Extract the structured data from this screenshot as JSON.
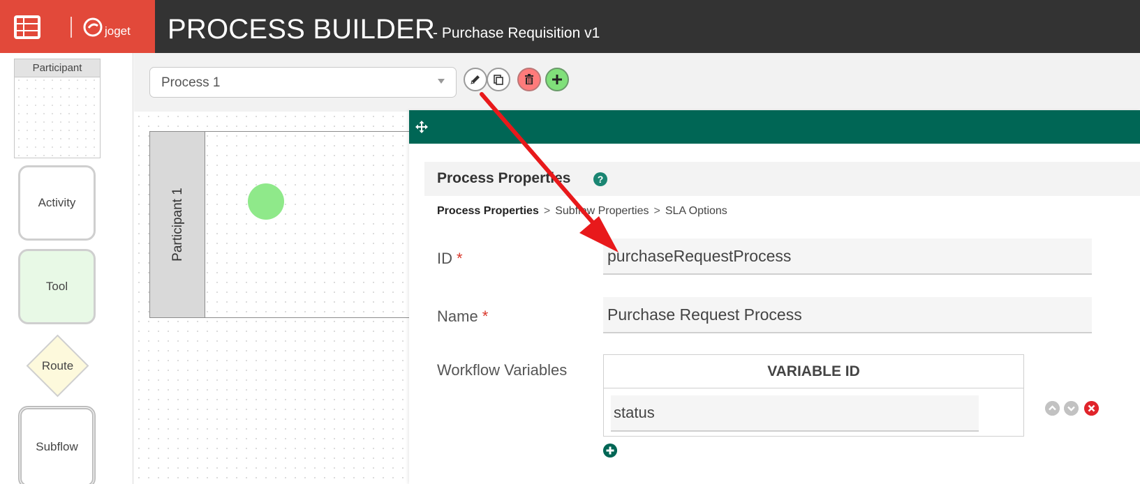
{
  "header": {
    "logo_text": "joget",
    "title": "PROCESS BUILDER",
    "subtitle": "- Purchase Requisition v1"
  },
  "palette": {
    "participant": "Participant",
    "activity": "Activity",
    "tool": "Tool",
    "route": "Route",
    "subflow": "Subflow"
  },
  "toolbar": {
    "process_select": "Process 1",
    "icons": [
      "pencil-icon",
      "copy-icon",
      "trash-icon",
      "plus-icon"
    ]
  },
  "canvas": {
    "lane_label": "Participant 1"
  },
  "panel": {
    "title": "Process Properties",
    "help": "?",
    "breadcrumb": [
      "Process Properties",
      "Subflow Properties",
      "SLA Options"
    ],
    "breadcrumb_sep": ">",
    "fields": {
      "id_label": "ID",
      "id_value": "purchaseRequestProcess",
      "name_label": "Name",
      "name_value": "Purchase Request Process",
      "required_mark": "*",
      "workflow_label": "Workflow Variables"
    },
    "variables": {
      "column_header": "VARIABLE ID",
      "rows": [
        "status"
      ]
    }
  },
  "colors": {
    "header_bg": "#333333",
    "brand_bg": "#e2493a",
    "panel_head": "#006655",
    "annotation_arrow": "#e8191b"
  }
}
